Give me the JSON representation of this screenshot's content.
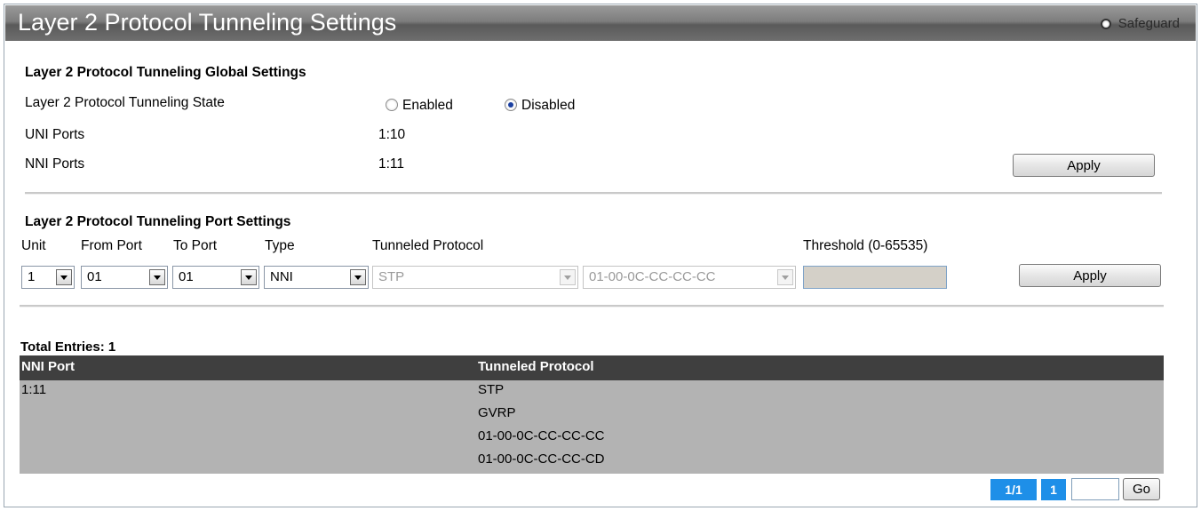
{
  "header": {
    "title": "Layer 2 Protocol Tunneling Settings",
    "safeguard_label": "Safeguard"
  },
  "global": {
    "heading": "Layer 2 Protocol Tunneling Global Settings",
    "state_label": "Layer 2 Protocol Tunneling State",
    "enabled_label": "Enabled",
    "disabled_label": "Disabled",
    "state_selected": "Disabled",
    "uni_label": "UNI Ports",
    "uni_value": "1:10",
    "nni_label": "NNI Ports",
    "nni_value": "1:11",
    "apply_label": "Apply"
  },
  "port": {
    "heading": "Layer 2 Protocol Tunneling Port Settings",
    "col_unit": "Unit",
    "col_from": "From Port",
    "col_to": "To Port",
    "col_type": "Type",
    "col_protocol": "Tunneled Protocol",
    "col_threshold": "Threshold (0-65535)",
    "unit_value": "1",
    "from_value": "01",
    "to_value": "01",
    "type_value": "NNI",
    "protocol_value": "STP",
    "mac_value": "01-00-0C-CC-CC-CC",
    "threshold_value": "",
    "apply_label": "Apply"
  },
  "table": {
    "total_label": "Total Entries: 1",
    "headers": [
      "NNI Port",
      "Tunneled Protocol"
    ],
    "rows": [
      {
        "port": "1:11",
        "protocols": [
          "STP",
          "GVRP",
          "01-00-0C-CC-CC-CC",
          "01-00-0C-CC-CC-CD"
        ]
      }
    ]
  },
  "pagination": {
    "page_indicator": "1/1",
    "page_number": "1",
    "go_label": "Go",
    "go_value": ""
  },
  "colors": {
    "header_bg": "#3f3f3f",
    "row_bg": "#b3b3b3",
    "pager_blue": "#1e8fe8"
  }
}
